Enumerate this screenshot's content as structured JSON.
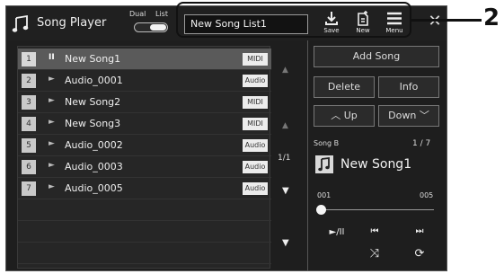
{
  "header": {
    "title": "Song Player",
    "dual_label": "Dual",
    "list_label": "List",
    "songlist_value": "New Song List1",
    "save_label": "Save",
    "new_label": "New",
    "menu_label": "Menu",
    "close_symbol": "✕"
  },
  "songs": [
    {
      "number": "1",
      "play": "II",
      "name": "New Song1",
      "type": "MIDI",
      "selected": true
    },
    {
      "number": "2",
      "play": "►",
      "name": "Audio_0001",
      "type": "Audio"
    },
    {
      "number": "3",
      "play": "►",
      "name": "New Song2",
      "type": "MIDI"
    },
    {
      "number": "4",
      "play": "►",
      "name": "New Song3",
      "type": "MIDI"
    },
    {
      "number": "5",
      "play": "►",
      "name": "Audio_0002",
      "type": "Audio"
    },
    {
      "number": "6",
      "play": "►",
      "name": "Audio_0003",
      "type": "Audio"
    },
    {
      "number": "7",
      "play": "►",
      "name": "Audio_0005",
      "type": "Audio"
    }
  ],
  "scroll": {
    "page": "1/1",
    "up": "▲",
    "down": "▼",
    "last": "▼"
  },
  "panel": {
    "add_song": "Add Song",
    "delete": "Delete",
    "info": "Info",
    "up": "Up",
    "down": "Down",
    "song_label": "Song B",
    "counter": "1 / 7",
    "current_song": "New Song1",
    "bar_start": "001",
    "bar_end": "005",
    "playback_position": 0.0
  },
  "transport": {
    "play_pause": "►/II",
    "prev": "⏮",
    "next": "⏭",
    "shuffle": "⤨",
    "repeat": "⟳"
  },
  "callout": {
    "number": "2"
  },
  "colors": {
    "screen_bg": "#1e1e1e",
    "selected_row": "#5a5a5a",
    "callout": "#111111"
  }
}
